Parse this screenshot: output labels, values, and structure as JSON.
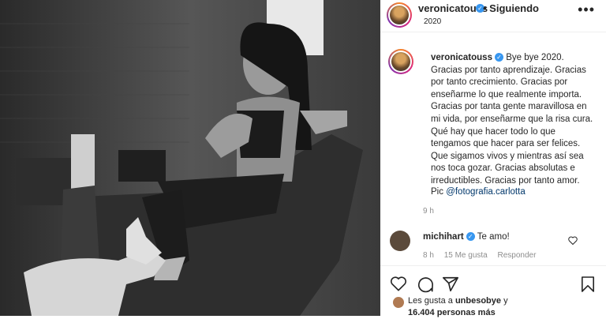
{
  "post": {
    "username": "veronicatouss",
    "following_label": "Siguiendo",
    "location": "2020",
    "more_label": "•••",
    "caption_text": "Bye bye 2020. Gracias por tanto aprendizaje. Gracias por tanto crecimiento. Gracias por enseñarme lo que realmente importa. Gracias por tanta gente maravillosa en mi vida, por enseñarme que la risa cura. Qué hay que hacer todo lo que tengamos que hacer para ser felices. Que sigamos vivos y mientras así sea nos toca gozar. Gracias absolutas e irreductibles. Gracias por tanto amor.",
    "pic_prefix": "Pic",
    "pic_mention": "@fotografia.carlotta",
    "time": "9 h"
  },
  "comment": {
    "username": "michihart",
    "text": "Te amo!",
    "time": "8 h",
    "likes": "15 Me gusta",
    "reply_label": "Responder"
  },
  "likes_line": {
    "prefix": "Les gusta a",
    "user": "unbesobye",
    "suffix": "y",
    "count": "16.404 personas más"
  },
  "colors": {
    "verified": "#3897f0",
    "mention": "#00376b"
  },
  "icons": [
    "heart-icon",
    "comment-icon",
    "share-icon",
    "bookmark-icon",
    "more-icon",
    "verified-icon"
  ]
}
